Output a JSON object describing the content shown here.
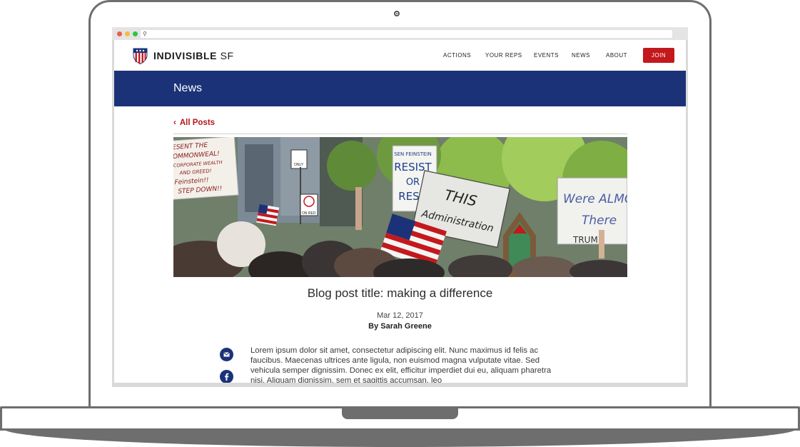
{
  "site": {
    "brand_bold": "INDIVISIBLE",
    "brand_light": "SF",
    "nav": [
      "ACTIONS",
      "YOUR REPS",
      "EVENTS",
      "NEWS",
      "ABOUT"
    ],
    "join_label": "JOIN"
  },
  "banner": {
    "title": "News"
  },
  "back_link": "All Posts",
  "hero_signs": {
    "sign1": [
      "ESENT THE",
      "OMMONWEAL!",
      "CORPORATE WEALTH",
      "AND GREED!",
      "Feinstein!!",
      "STEP DOWN!!"
    ],
    "sign2": [
      "SEN FEINSTEIN",
      "RESIST",
      "OR",
      "RESIG"
    ],
    "sign3": [
      "THIS",
      "Administration"
    ],
    "sign4": [
      "Were ALMOS",
      "There"
    ],
    "sign5": "TRUM",
    "street_sign_only": "ONLY",
    "street_sign_red": "ON RED"
  },
  "post": {
    "title": "Blog post title: making a difference",
    "date": "Mar 12, 2017",
    "author": "By Sarah Greene",
    "body": "Lorem ipsum dolor sit amet, consectetur adipiscing elit. Nunc maximus id felis ac faucibus. Maecenas ultrices ante ligula, non euismod magna vulputate vitae. Sed vehicula semper dignissim. Donec ex elit, efficitur imperdiet dui eu, aliquam pharetra nisi. Aliquam dignissim, sem et sagittis accumsan, leo"
  },
  "share_icons": [
    "email-icon",
    "facebook-icon"
  ],
  "colors": {
    "navy": "#1b3278",
    "red": "#c3191c",
    "link_red": "#b5161b"
  }
}
